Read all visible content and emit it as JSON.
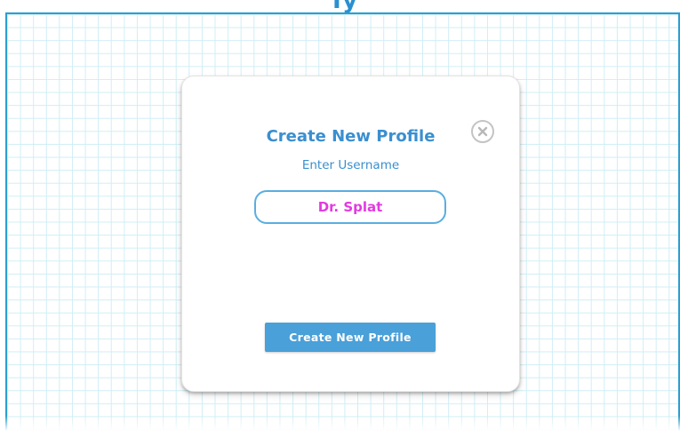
{
  "modal": {
    "title": "Create New Profile",
    "subtitle": "Enter Username",
    "username_value": "Dr. Splat",
    "submit_label": "Create New Profile",
    "close_icon": "close-circle-icon"
  },
  "colors": {
    "accent": "#3a8fcf",
    "button": "#4aa0d8",
    "input_text": "#e23be0",
    "grid_line": "#cfeef5",
    "frame_border": "#2a9fd0"
  }
}
